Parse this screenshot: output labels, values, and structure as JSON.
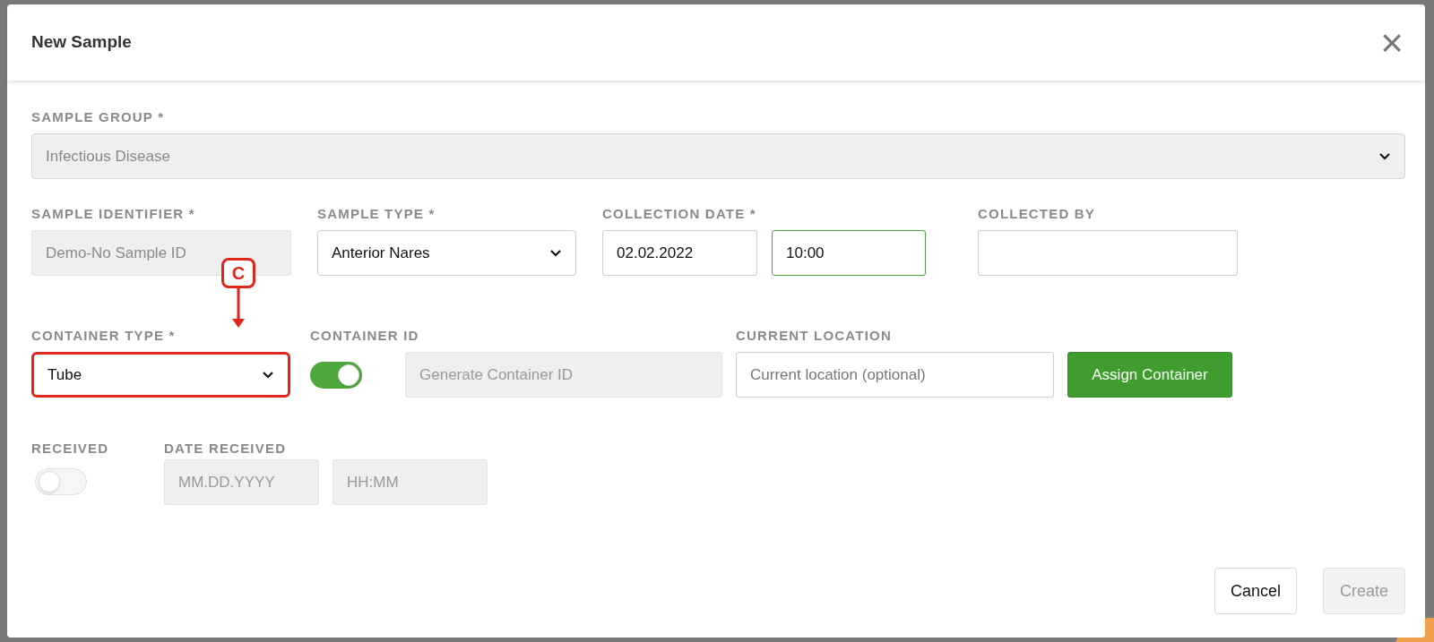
{
  "dialog": {
    "title": "New Sample",
    "close": "×"
  },
  "sample_group": {
    "label": "SAMPLE GROUP *",
    "value": "Infectious Disease",
    "disabled": true
  },
  "row2": [
    {
      "kind": "text",
      "label": "SAMPLE IDENTIFIER *",
      "value": "Demo-No Sample ID",
      "disabled": true
    },
    {
      "kind": "select",
      "label": "SAMPLE TYPE *",
      "value": "Anterior Nares",
      "disabled": false
    },
    {
      "kind": "datetime",
      "label": "COLLECTION DATE *",
      "date": "02.02.2022",
      "time": "10:00",
      "focused": true
    },
    {
      "kind": "text",
      "label": "COLLECTED BY",
      "disabled": false
    }
  ],
  "container_type": {
    "label": "CONTAINER TYPE *",
    "value": "Tube",
    "highlighted": true,
    "callout": "C"
  },
  "container_id": {
    "label": "CONTAINER ID",
    "on": true,
    "placeholder": "Generate Container ID"
  },
  "current_location": {
    "label": "CURRENT LOCATION",
    "placeholder": "Current location (optional)"
  },
  "assign_button": "Assign Container",
  "received": {
    "label": "RECEIVED",
    "on": false
  },
  "date_received": {
    "label": "DATE RECEIVED",
    "date_placeholder": "MM.DD.YYYY",
    "time_placeholder": "HH:MM"
  },
  "buttons": [
    {
      "label": "Cancel",
      "disabled": false
    },
    {
      "label": "Create",
      "disabled": true
    }
  ]
}
